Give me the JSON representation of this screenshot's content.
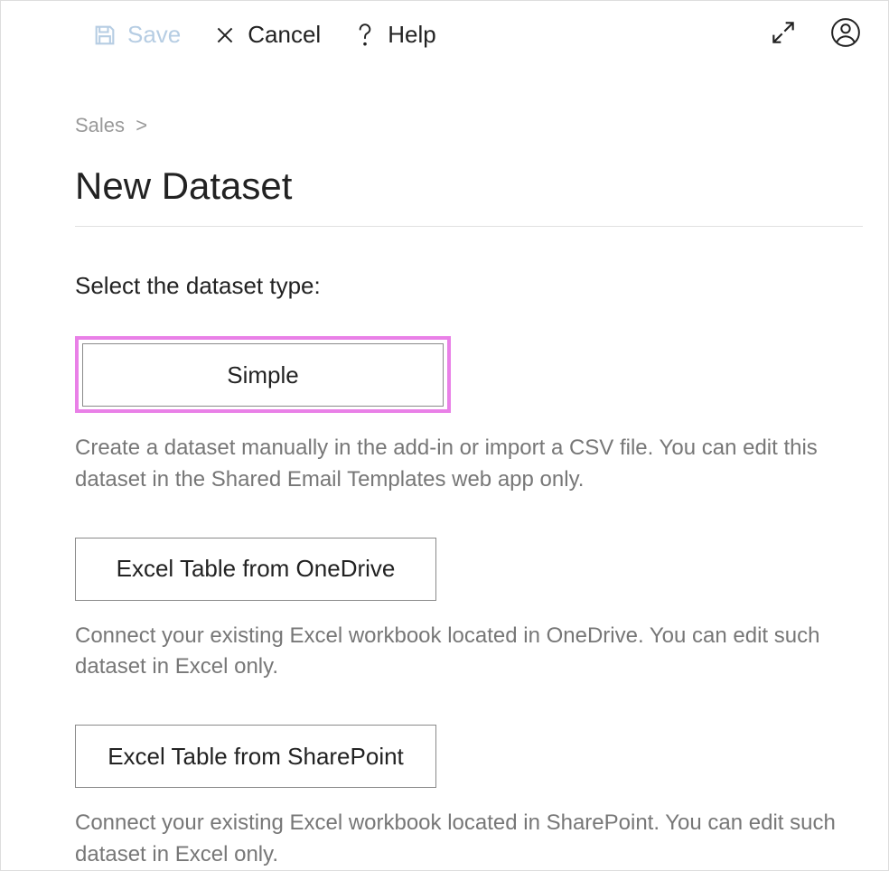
{
  "toolbar": {
    "save_label": "Save",
    "cancel_label": "Cancel",
    "help_label": "Help"
  },
  "breadcrumb": {
    "items": [
      "Sales"
    ],
    "separator": ">"
  },
  "page": {
    "title": "New Dataset",
    "prompt": "Select the dataset type:"
  },
  "options": [
    {
      "label": "Simple",
      "highlighted": true,
      "description": "Create a dataset manually in the add-in or import a CSV file. You can edit this dataset in the Shared Email Templates web app only."
    },
    {
      "label": "Excel Table from OneDrive",
      "highlighted": false,
      "description": "Connect your existing Excel workbook located in OneDrive. You can edit such dataset in Excel only."
    },
    {
      "label": "Excel Table from SharePoint",
      "highlighted": false,
      "description": "Connect your existing Excel workbook located in SharePoint. You can edit such dataset in Excel only."
    }
  ]
}
